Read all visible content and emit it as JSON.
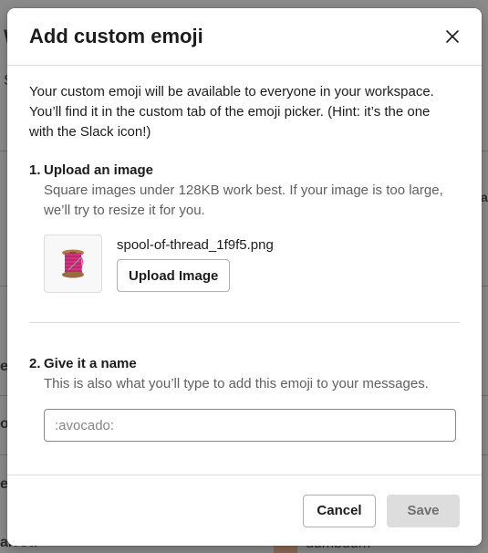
{
  "background": {
    "fragments": [
      "W",
      "S",
      "a",
      "ep",
      "ol",
      "ea",
      "arrot:",
      "dumbdum"
    ]
  },
  "modal": {
    "title": "Add custom emoji",
    "close_icon": "close-icon",
    "intro": "Your custom emoji will be available to everyone in your workspace. You’ll find it in the custom tab of the emoji picker. (Hint: it’s the one with the Slack icon!)",
    "step1": {
      "number": "1.",
      "title": "Upload an image",
      "hint": "Square images under 128KB work best. If your image is too large, we’ll try to resize it for you.",
      "preview_icon": "spool-of-thread-icon",
      "file_name": "spool-of-thread_1f9f5.png",
      "upload_label": "Upload Image"
    },
    "step2": {
      "number": "2.",
      "title": "Give it a name",
      "hint": "This is also what you’ll type to add this emoji to your messages.",
      "placeholder": ":avocado:"
    },
    "footer": {
      "cancel_label": "Cancel",
      "save_label": "Save"
    }
  },
  "colors": {
    "text": "#1d1c1d",
    "muted": "#616061",
    "disabled_button": "#dddddd",
    "overlay": "#8a8a8a"
  }
}
